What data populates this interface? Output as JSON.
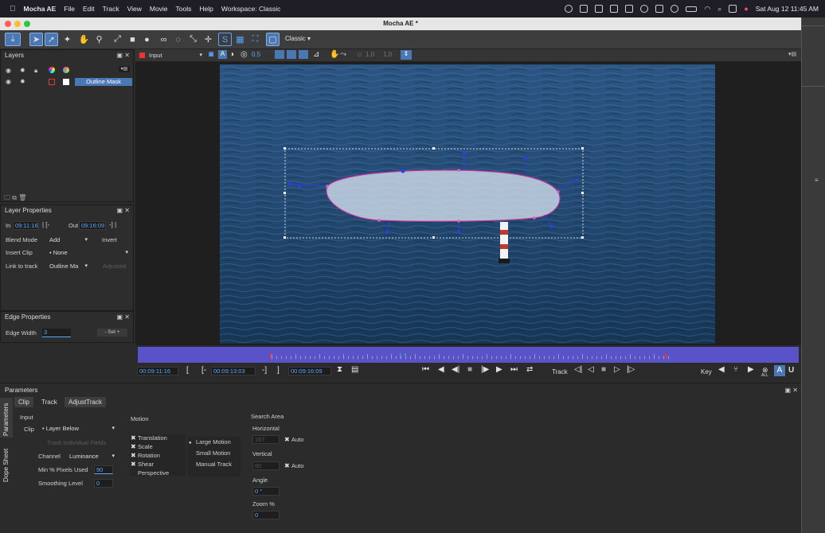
{
  "menubar": {
    "app": "Mocha AE",
    "items": [
      "File",
      "Edit",
      "Track",
      "View",
      "Movie",
      "Tools",
      "Help"
    ],
    "workspace": "Workspace: Classic",
    "datetime": "Sat Aug 12  11:45 AM"
  },
  "window": {
    "title": "Mocha AE *"
  },
  "toolbar": {
    "workspace_select": "Classic"
  },
  "layers_panel": {
    "title": "Layers",
    "layer_name": "Outline Mask"
  },
  "layer_properties": {
    "title": "Layer Properties",
    "in_label": "In",
    "in_value": "09:11:16",
    "out_label": "Out",
    "out_value": "09:16:09",
    "blend_mode_label": "Blend Mode",
    "blend_mode_value": "Add",
    "invert_label": "Invert",
    "insert_clip_label": "Insert Clip",
    "insert_clip_value": "None",
    "link_to_track_label": "Link to track",
    "link_to_track_value": "Outline Ma",
    "adjusted_label": "Adjusted"
  },
  "edge_properties": {
    "title": "Edge Properties",
    "edge_width_label": "Edge Width",
    "edge_width_value": "3",
    "set_label": "Set"
  },
  "viewer": {
    "clip_select": "Input",
    "opacity_value": "0.5",
    "field_a": "1.0",
    "field_b": "1.0"
  },
  "timeline": {
    "current_time": "00:09:11:16",
    "in_time": "00:09:13:03",
    "out_time": "00:09:16:09",
    "track_label": "Track",
    "key_label": "Key",
    "all_label": "ALL"
  },
  "parameters": {
    "title": "Parameters",
    "tabs": [
      "Clip",
      "Track",
      "AdjustTrack"
    ],
    "side_tabs": [
      "Parameters",
      "Dope Sheet"
    ],
    "input_section": "Input",
    "clip_label": "Clip",
    "clip_value": "Layer Below",
    "track_individual_fields": "Track Individual Fields",
    "channel_label": "Channel",
    "channel_value": "Luminance",
    "min_pixels_label": "Min % Pixels Used",
    "min_pixels_value": "90",
    "smoothing_label": "Smoothing Level",
    "smoothing_value": "0",
    "motion_section": "Motion",
    "motion_options": [
      "Translation",
      "Scale",
      "Rotation",
      "Shear",
      "Perspective"
    ],
    "motion_modes": [
      "Large Motion",
      "Small Motion",
      "Manual Track"
    ],
    "search_area_section": "Search Area",
    "horizontal_label": "Horizontal",
    "horizontal_value": "167",
    "vertical_label": "Vertical",
    "vertical_value": "60",
    "auto_label": "Auto",
    "angle_label": "Angle",
    "angle_value": "0 °",
    "zoom_label": "Zoom %",
    "zoom_value": "0"
  },
  "colors": {
    "accent": "#4a78b5",
    "timecode": "#5aa7ff",
    "timeline_bar": "#5a52c8",
    "spline": "#c0309a",
    "water": "#234a72"
  }
}
